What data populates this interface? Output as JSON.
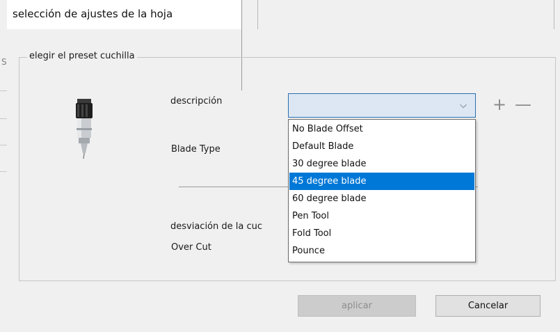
{
  "background": {
    "left_char": "S"
  },
  "dialog": {
    "title": "selección de ajustes de la hoja",
    "group_title": "elegir el preset cuchilla",
    "labels": {
      "description": "descripción",
      "blade_type": "Blade Type",
      "blade_offset": "desviación de la cuc",
      "over_cut": "Over Cut"
    },
    "combo": {
      "value": "",
      "arrow": "⌵"
    },
    "plus": "+",
    "minus": "—",
    "dropdown": {
      "options": [
        "No Blade Offset",
        "Default Blade",
        "30 degree blade",
        "45 degree blade",
        "60 degree blade",
        "Pen Tool",
        "Fold Tool",
        "Pounce"
      ],
      "selected": "45 degree blade"
    },
    "buttons": {
      "apply": "aplicar",
      "cancel": "Cancelar"
    }
  },
  "colors": {
    "selection": "#0078d7",
    "combo_border": "#2a6fb0"
  },
  "icons": [
    "blade-tool-icon",
    "chevron-down-icon",
    "plus-icon",
    "minus-icon"
  ]
}
